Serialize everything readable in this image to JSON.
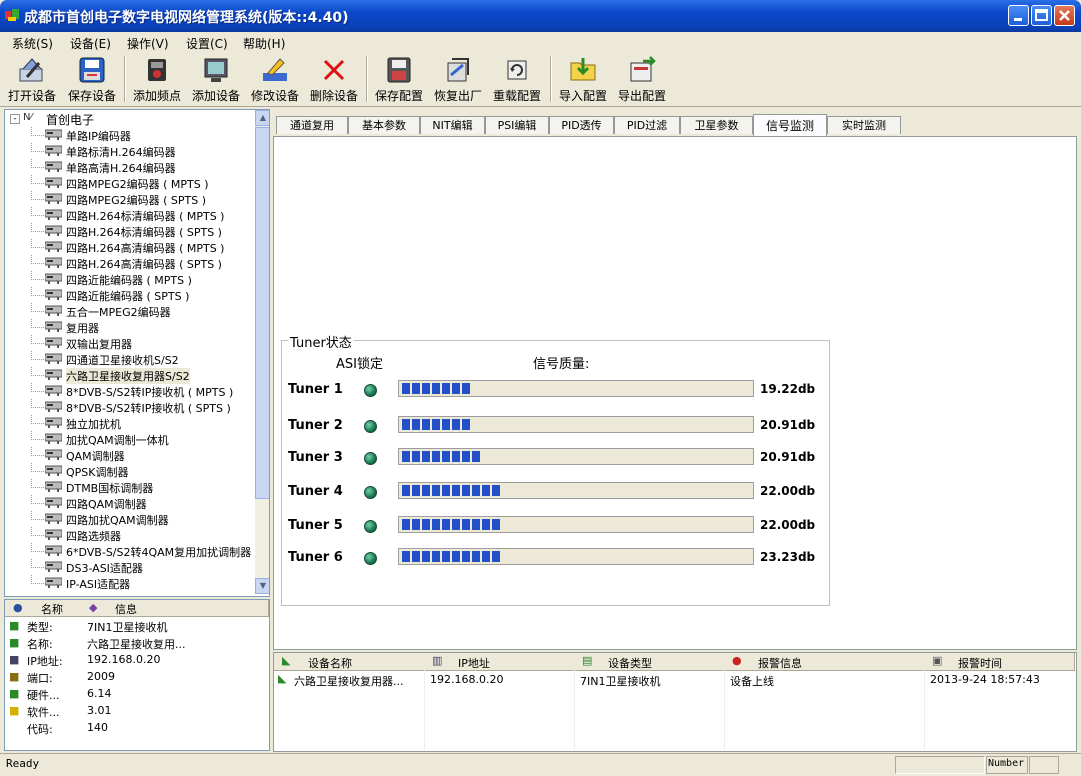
{
  "window": {
    "title": "成都市首创电子数字电视网络管理系统(版本::4.40)"
  },
  "menu": [
    "系统(S)",
    "设备(E)",
    "操作(V)",
    "设置(C)",
    "帮助(H)"
  ],
  "toolbar": [
    {
      "label": "打开设备",
      "icon": "open-device-icon"
    },
    {
      "label": "保存设备",
      "icon": "save-device-icon"
    },
    {
      "label": "添加频点",
      "icon": "add-frequency-icon"
    },
    {
      "label": "添加设备",
      "icon": "add-device-icon"
    },
    {
      "label": "修改设备",
      "icon": "edit-device-icon"
    },
    {
      "label": "删除设备",
      "icon": "delete-device-icon"
    },
    {
      "label": "保存配置",
      "icon": "save-config-icon"
    },
    {
      "label": "恢复出厂",
      "icon": "factory-reset-icon"
    },
    {
      "label": "重载配置",
      "icon": "reload-config-icon"
    },
    {
      "label": "导入配置",
      "icon": "import-config-icon"
    },
    {
      "label": "导出配置",
      "icon": "export-config-icon"
    }
  ],
  "tree": {
    "root": "首创电子",
    "items": [
      "单路IP编码器",
      "单路标清H.264编码器",
      "单路高清H.264编码器",
      "四路MPEG2编码器 ( MPTS )",
      "四路MPEG2编码器 ( SPTS )",
      "四路H.264标清编码器 ( MPTS )",
      "四路H.264标清编码器 ( SPTS )",
      "四路H.264高清编码器 ( MPTS )",
      "四路H.264高清编码器 ( SPTS )",
      "四路近能编码器 ( MPTS )",
      "四路近能编码器 ( SPTS )",
      "五合一MPEG2编码器",
      "复用器",
      "双输出复用器",
      "四通道卫星接收机S/S2",
      "六路卫星接收复用器S/S2",
      "8*DVB-S/S2转IP接收机 ( MPTS )",
      "8*DVB-S/S2转IP接收机 ( SPTS )",
      "独立加扰机",
      "加扰QAM调制一体机",
      "QAM调制器",
      "QPSK调制器",
      "DTMB国标调制器",
      "四路QAM调制器",
      "四路加扰QAM调制器",
      "四路选频器",
      "6*DVB-S/S2转4QAM复用加扰调制器",
      "DS3-ASI适配器",
      "IP-ASI适配器"
    ],
    "selected_index": 15
  },
  "info": {
    "headers": [
      "名称",
      "信息"
    ],
    "rows": [
      {
        "key": "类型:",
        "value": "7IN1卫星接收机"
      },
      {
        "key": "名称:",
        "value": "六路卫星接收复用..."
      },
      {
        "key": "IP地址:",
        "value": "192.168.0.20"
      },
      {
        "key": "端口:",
        "value": "2009"
      },
      {
        "key": "硬件...",
        "value": "6.14"
      },
      {
        "key": "软件...",
        "value": "3.01"
      },
      {
        "key": "代码:",
        "value": "140"
      }
    ]
  },
  "tabs": [
    "通道复用",
    "基本参数",
    "NIT编辑",
    "PSI编辑",
    "PID透传",
    "PID过滤",
    "卫星参数",
    "信号监测",
    "实时监测"
  ],
  "active_tab": 7,
  "tuner": {
    "group_title": "Tuner状态",
    "asi_label": "ASI锁定",
    "quality_label": "信号质量:",
    "rows": [
      {
        "name": "Tuner 1",
        "segments": 7,
        "value": "19.22db"
      },
      {
        "name": "Tuner 2",
        "segments": 7,
        "value": "20.91db"
      },
      {
        "name": "Tuner 3",
        "segments": 8,
        "value": "20.91db"
      },
      {
        "name": "Tuner 4",
        "segments": 10,
        "value": "22.00db"
      },
      {
        "name": "Tuner 5",
        "segments": 10,
        "value": "22.00db"
      },
      {
        "name": "Tuner 6",
        "segments": 10,
        "value": "23.23db"
      }
    ]
  },
  "alarm": {
    "headers": [
      "设备名称",
      "IP地址",
      "设备类型",
      "报警信息",
      "报警时间"
    ],
    "rows": [
      [
        "六路卫星接收复用器...",
        "192.168.0.20",
        "7IN1卫星接收机",
        "设备上线",
        "2013-9-24 18:57:43"
      ]
    ]
  },
  "status": {
    "left": "Ready",
    "right": "Number"
  },
  "colors": {
    "title_bar": "#0a47c9",
    "bar_fill": "#2350c6",
    "led": "#0e6a44"
  }
}
